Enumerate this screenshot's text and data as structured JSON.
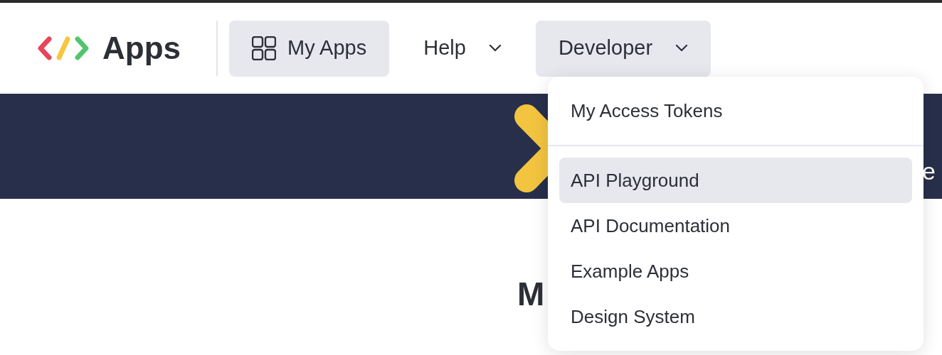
{
  "header": {
    "logo_text": "Apps",
    "nav": [
      {
        "label": "My Apps",
        "kind": "link",
        "selected": true
      },
      {
        "label": "Help",
        "kind": "dropdown",
        "expanded": false
      },
      {
        "label": "Developer",
        "kind": "dropdown",
        "expanded": true
      }
    ]
  },
  "banner": {
    "text": "e"
  },
  "main": {
    "heading": "M"
  },
  "developer_menu": {
    "sections": [
      [
        {
          "label": "My Access Tokens",
          "selected": false
        }
      ],
      [
        {
          "label": "API Playground",
          "selected": true
        },
        {
          "label": "API Documentation",
          "selected": false
        },
        {
          "label": "Example Apps",
          "selected": false
        },
        {
          "label": "Design System",
          "selected": false
        }
      ]
    ]
  }
}
